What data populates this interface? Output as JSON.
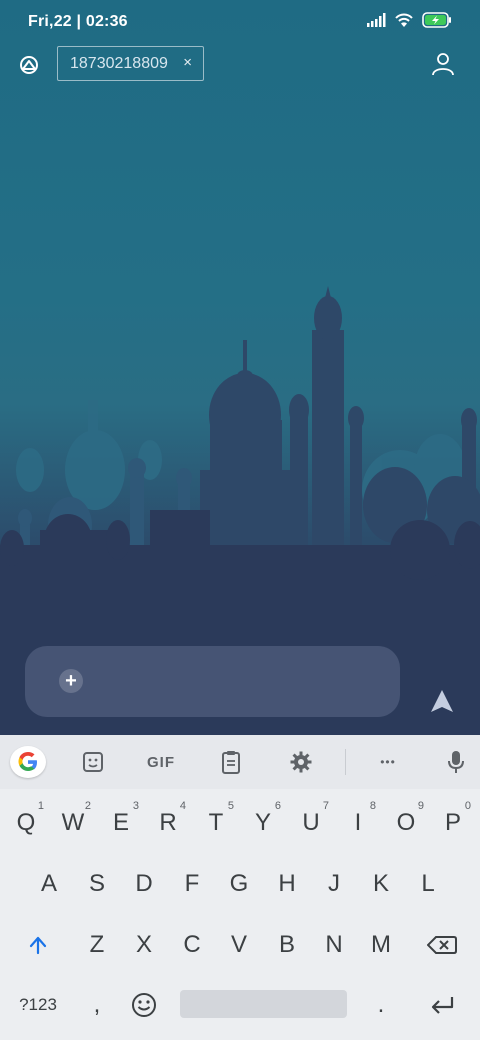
{
  "status_bar": {
    "time": "Fri,22 | 02:36",
    "icons": [
      "signal-icon",
      "wifi-icon",
      "battery-charging-icon"
    ],
    "battery_color": "#3ec95a"
  },
  "header": {
    "contact_icon": "contacts-icon",
    "recipient_chip": "18730218809",
    "chip_close": "×",
    "profile_icon": "person-icon"
  },
  "composer": {
    "attach_label": "+",
    "message_value": "",
    "placeholder": "",
    "send_icon": "send-icon"
  },
  "keyboard": {
    "toolbar": {
      "items": [
        "google-icon",
        "sticker-icon",
        "GIF",
        "clipboard-icon",
        "settings-icon",
        "more-icon",
        "mic-icon"
      ],
      "gif_label": "GIF",
      "more_label": "•••"
    },
    "row1": [
      {
        "key": "Q",
        "hint": "1"
      },
      {
        "key": "W",
        "hint": "2"
      },
      {
        "key": "E",
        "hint": "3"
      },
      {
        "key": "R",
        "hint": "4"
      },
      {
        "key": "T",
        "hint": "5"
      },
      {
        "key": "Y",
        "hint": "6"
      },
      {
        "key": "U",
        "hint": "7"
      },
      {
        "key": "I",
        "hint": "8"
      },
      {
        "key": "O",
        "hint": "9"
      },
      {
        "key": "P",
        "hint": "0"
      }
    ],
    "row2": [
      "A",
      "S",
      "D",
      "F",
      "G",
      "H",
      "J",
      "K",
      "L"
    ],
    "row3": [
      "Z",
      "X",
      "C",
      "V",
      "B",
      "N",
      "M"
    ],
    "bottom": {
      "symbols": "?123",
      "comma": ",",
      "period": ".",
      "emoji_icon": "emoji-icon",
      "enter_icon": "enter-icon",
      "shift_icon": "shift-icon",
      "backspace_icon": "backspace-icon"
    },
    "accent": "#1a73e8"
  },
  "colors": {
    "sky_top": "#1f6b84",
    "skyline_dark": "#2b3a5a"
  }
}
